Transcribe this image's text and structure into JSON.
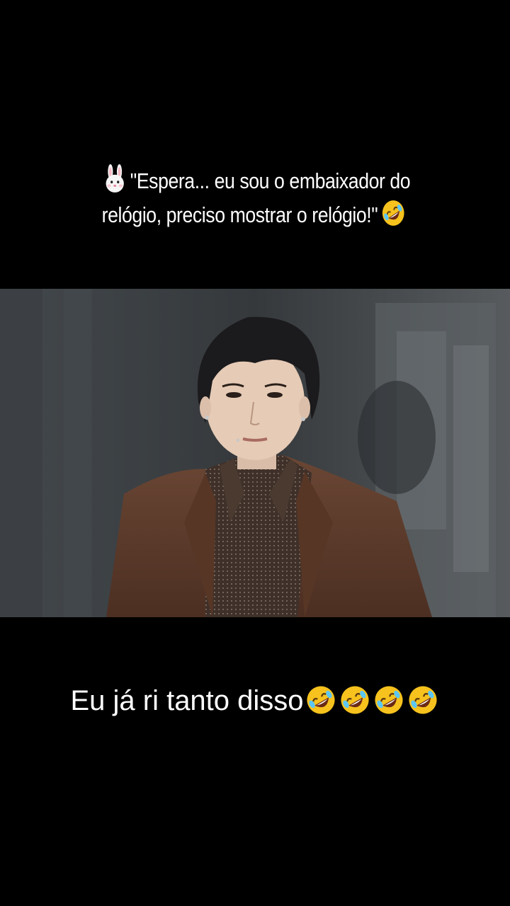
{
  "caption_top": {
    "line1": "\"Espera... eu sou o embaixador do",
    "line2": "relógio, preciso mostrar o relógio!\"",
    "lead_icon": "rabbit-face-emoji",
    "trail_icon": "rolling-on-floor-laughing-emoji"
  },
  "caption_bottom": {
    "text": "Eu já ri tanto disso",
    "trail_icons": [
      "rolling-on-floor-laughing-emoji",
      "rolling-on-floor-laughing-emoji",
      "rolling-on-floor-laughing-emoji",
      "rolling-on-floor-laughing-emoji"
    ]
  },
  "video": {
    "subject": "man in brown suit and patterned shirt at event"
  },
  "colors": {
    "background": "#000000",
    "text": "#ffffff",
    "suit": "#5a3a2c",
    "backdrop": "#3f4244"
  }
}
